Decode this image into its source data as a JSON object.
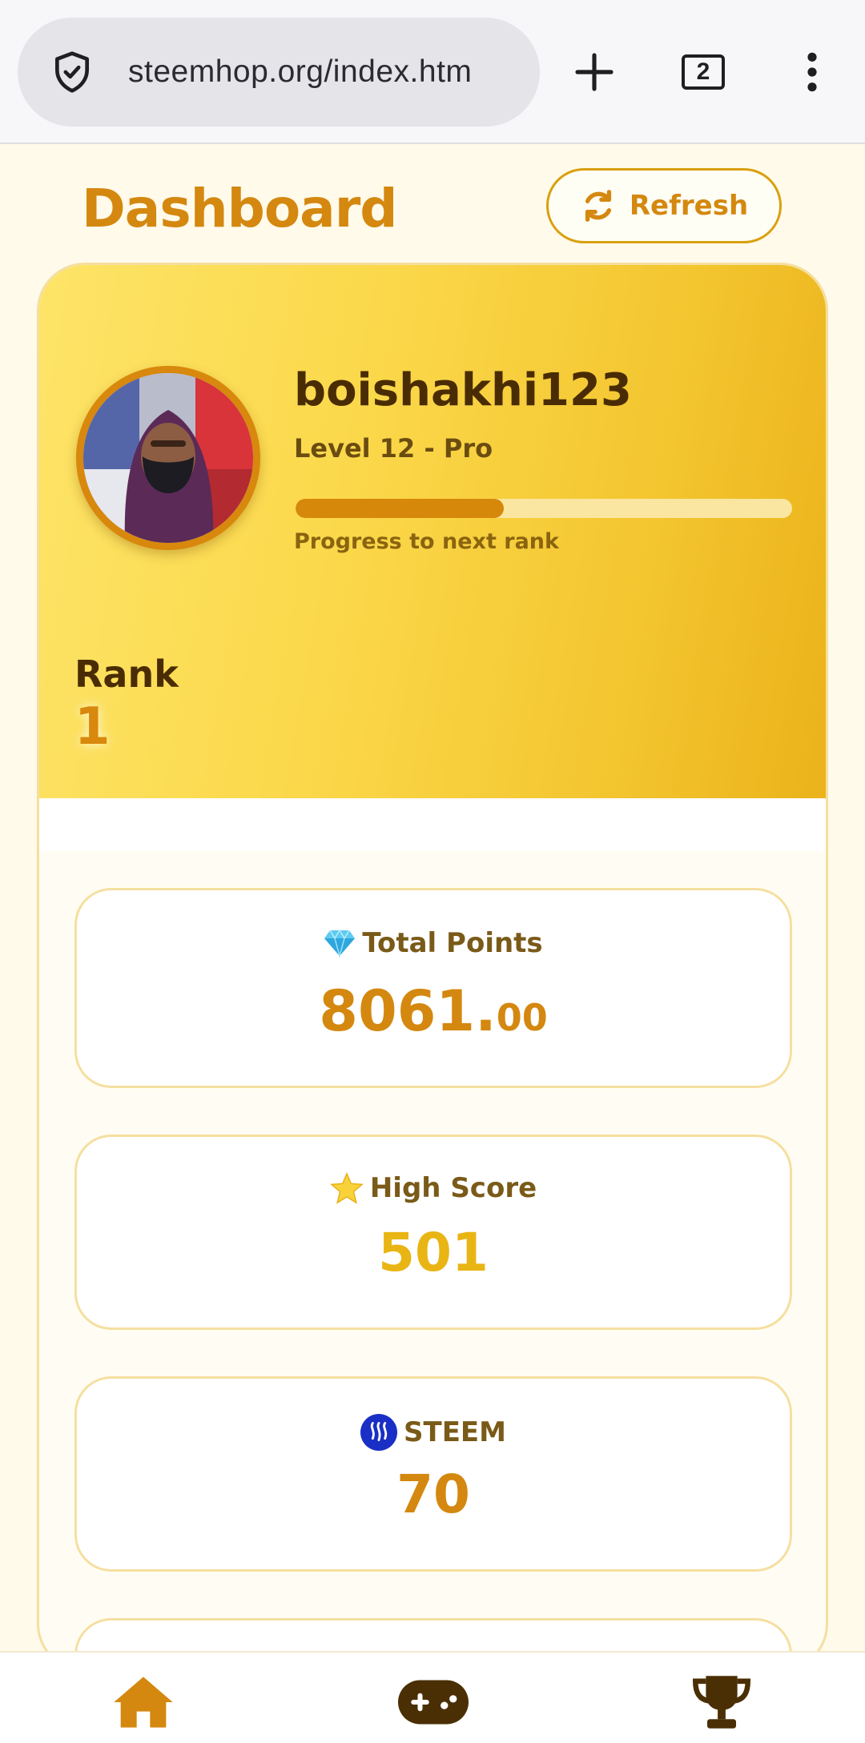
{
  "browser": {
    "url": "steemhop.org/index.htm",
    "tab_count": "2",
    "icons": [
      "shield-icon",
      "plus-icon",
      "tabs-icon",
      "more-vert-icon"
    ]
  },
  "header": {
    "title": "Dashboard",
    "refresh_label": "Refresh"
  },
  "profile": {
    "username": "boishakhi123",
    "level": "Level 12 - Pro",
    "progress_label": "Progress to next rank",
    "progress_fraction": 0.42,
    "rank_label": "Rank",
    "rank_value": "1"
  },
  "stats": [
    {
      "label": "Total Points",
      "icon": "gem-icon",
      "value_int": "8061.",
      "value_dec": "00"
    },
    {
      "label": "High Score",
      "icon": "star-icon",
      "value": "501"
    },
    {
      "label": "STEEM",
      "icon": "steem-icon",
      "value": "70"
    }
  ],
  "bottom_nav": [
    "home-icon",
    "gamepad-icon",
    "trophy-icon"
  ],
  "colors": {
    "accent": "#d4880f",
    "gold": "#e9b514",
    "text_dark": "#4a2c04"
  }
}
